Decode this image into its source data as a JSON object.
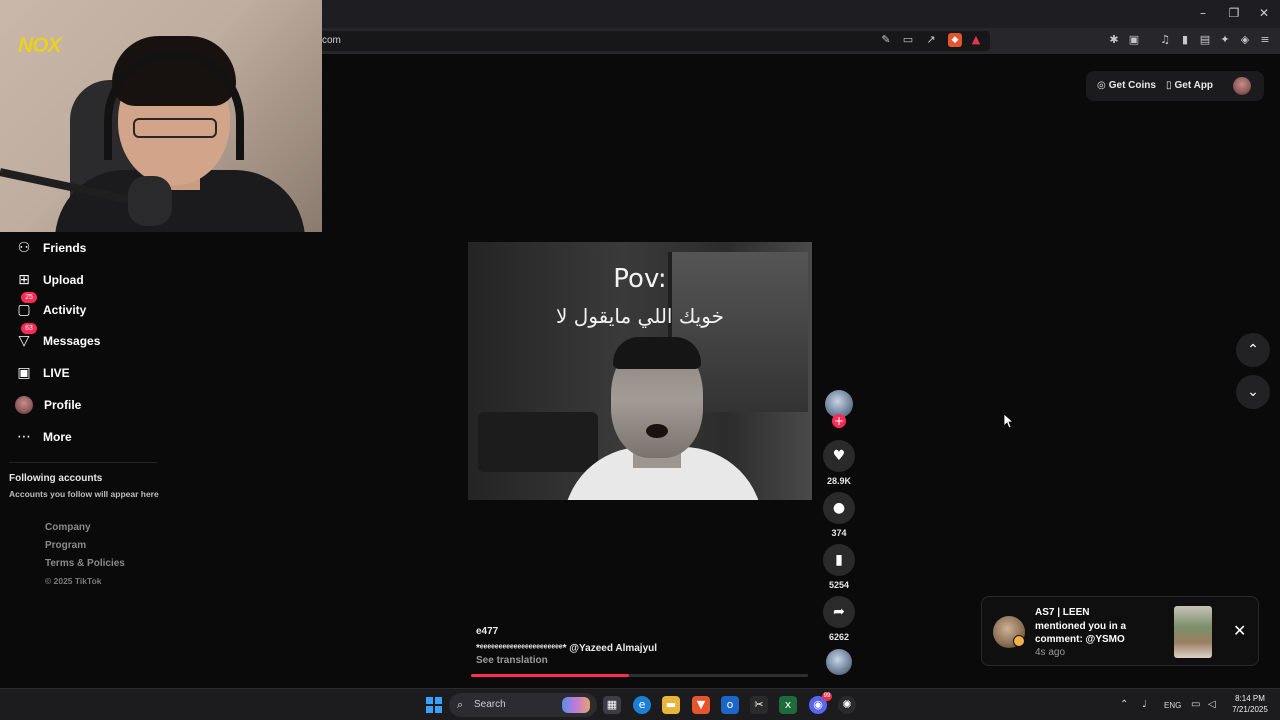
{
  "browser": {
    "url_text": "com",
    "window_controls": [
      "minimize-icon",
      "restore-icon",
      "close-icon"
    ]
  },
  "overlay": {
    "logo_text": "NOX"
  },
  "sidebar": {
    "items": [
      {
        "label": "Friends",
        "icon": "friends-icon",
        "badge": ""
      },
      {
        "label": "Upload",
        "icon": "upload-icon",
        "badge": ""
      },
      {
        "label": "Activity",
        "icon": "activity-icon",
        "badge": "25"
      },
      {
        "label": "Messages",
        "icon": "messages-icon",
        "badge": "63"
      },
      {
        "label": "LIVE",
        "icon": "live-icon",
        "badge": ""
      },
      {
        "label": "Profile",
        "icon": "avatar",
        "badge": ""
      },
      {
        "label": "More",
        "icon": "more-icon",
        "badge": ""
      }
    ],
    "following_title": "Following accounts",
    "following_sub": "Accounts you follow will appear here",
    "footer_links": [
      "Company",
      "Program",
      "Terms & Policies"
    ],
    "copyright": "© 2025 TikTok"
  },
  "header": {
    "get_coins": "Get Coins",
    "get_app": "Get App"
  },
  "video": {
    "overlay_title": "Pov:",
    "overlay_arabic": "خويك اللي مايقول لا",
    "username": "e477",
    "caption": "*ᵉᵉᵉᵉᵉᵉᵉᵉᵉᵉᵉᵉᵉᵉᵉᵉᵉᵉᵉᵉᵉᵉ* @Yazeed Almajyul",
    "see_translation": "See translation",
    "progress_fraction": 0.47
  },
  "actions": {
    "likes": "28.9K",
    "comments": "374",
    "bookmarks": "5254",
    "shares": "6262"
  },
  "notification": {
    "name": "AS7 | LEEN",
    "message": "mentioned you in a comment: @YSMO",
    "time": "4s ago"
  },
  "taskbar": {
    "search_placeholder": "Search",
    "language": "ENG",
    "time": "8:14 PM",
    "date": "7/21/2025",
    "discord_badge": "99"
  }
}
